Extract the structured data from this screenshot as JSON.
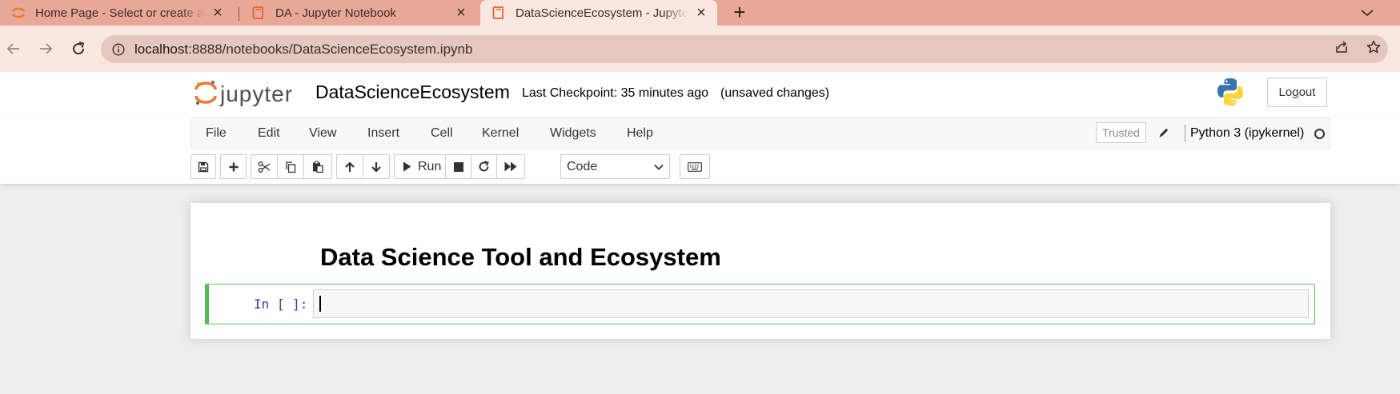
{
  "browser": {
    "tabs": [
      {
        "title": "Home Page - Select or create a notebook",
        "icon": "jupyter-orbit-icon",
        "active": false
      },
      {
        "title": "DA - Jupyter Notebook",
        "icon": "notebook-book-icon",
        "active": false
      },
      {
        "title": "DataScienceEcosystem - Jupyter Notebook",
        "icon": "notebook-book-icon",
        "active": true
      }
    ],
    "new_tab": "+",
    "url_host": "localhost",
    "url_rest": ":8888/notebooks/DataScienceEcosystem.ipynb"
  },
  "jupyter": {
    "logo_text": "jupyter",
    "notebook_name": "DataScienceEcosystem",
    "checkpoint": "Last Checkpoint: 35 minutes ago",
    "unsaved": "(unsaved changes)",
    "logout": "Logout",
    "menu": [
      "File",
      "Edit",
      "View",
      "Insert",
      "Cell",
      "Kernel",
      "Widgets",
      "Help"
    ],
    "trusted": "Trusted",
    "kernel": "Python 3 (ipykernel)",
    "toolbar": {
      "run_label": "Run",
      "cell_type": "Code"
    },
    "cells": {
      "markdown_heading": "Data Science Tool and Ecosystem",
      "code_prompt": "In [ ]:"
    }
  },
  "colors": {
    "tabbar": "#e8a898",
    "active_tab": "#fbe7e1",
    "jupyter_orange": "#f37726",
    "cell_selected_border": "#5cb85c",
    "prompt_blue": "#303f9f"
  }
}
